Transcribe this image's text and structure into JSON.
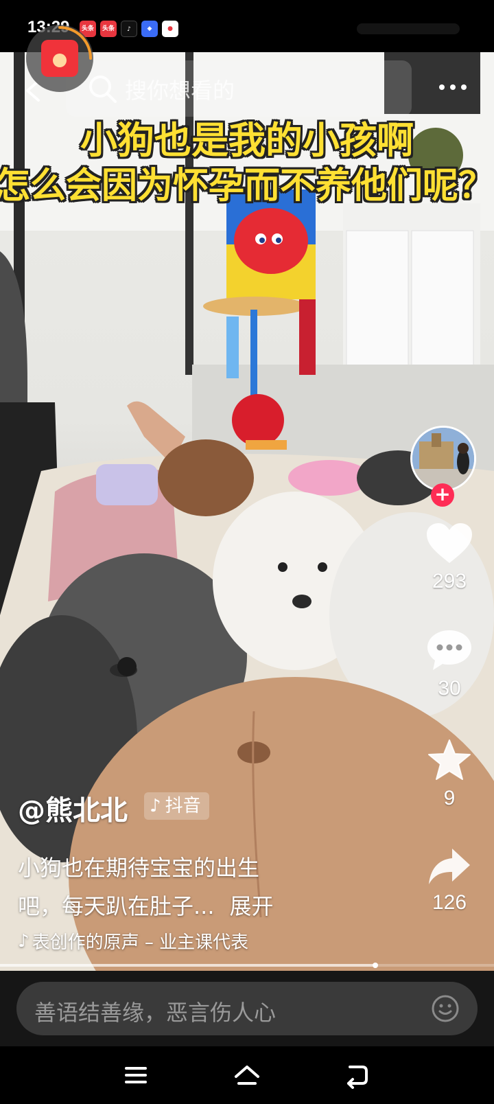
{
  "status_bar": {
    "time": "13:29",
    "app_badges": [
      {
        "icon": "toutiao-icon",
        "text": "头条",
        "bg": "#e8363f"
      },
      {
        "icon": "toutiao-icon",
        "text": "头条",
        "bg": "#e8363f"
      },
      {
        "icon": "douyin-icon",
        "text": "♪",
        "bg": "#111111"
      },
      {
        "icon": "app-icon",
        "text": "◆",
        "bg": "#3b6cf6"
      },
      {
        "icon": "map-pin-icon",
        "text": "●",
        "bg": "#ffffff"
      }
    ]
  },
  "search": {
    "placeholder": "搜你想看的"
  },
  "video": {
    "caption_line1": "小狗也是我的小孩啊",
    "caption_line2": "怎么会因为怀孕而不养他们呢？"
  },
  "actions": {
    "likes": "293",
    "comments": "30",
    "favorites": "9",
    "shares": "126"
  },
  "post": {
    "author": "@熊北北",
    "platform_tag": "抖音",
    "description_line1": "小狗也在期待宝宝的出生",
    "description_line2": "吧，每天趴在肚子...",
    "expand_label": "展开",
    "music": "表创作的原声 – 业主课代表"
  },
  "playback": {
    "progress": 0.76
  },
  "comment_bar": {
    "placeholder": "善语结善缘，恶言伤人心"
  },
  "colors": {
    "accent": "#fe2c55",
    "caption": "#ffe033"
  }
}
